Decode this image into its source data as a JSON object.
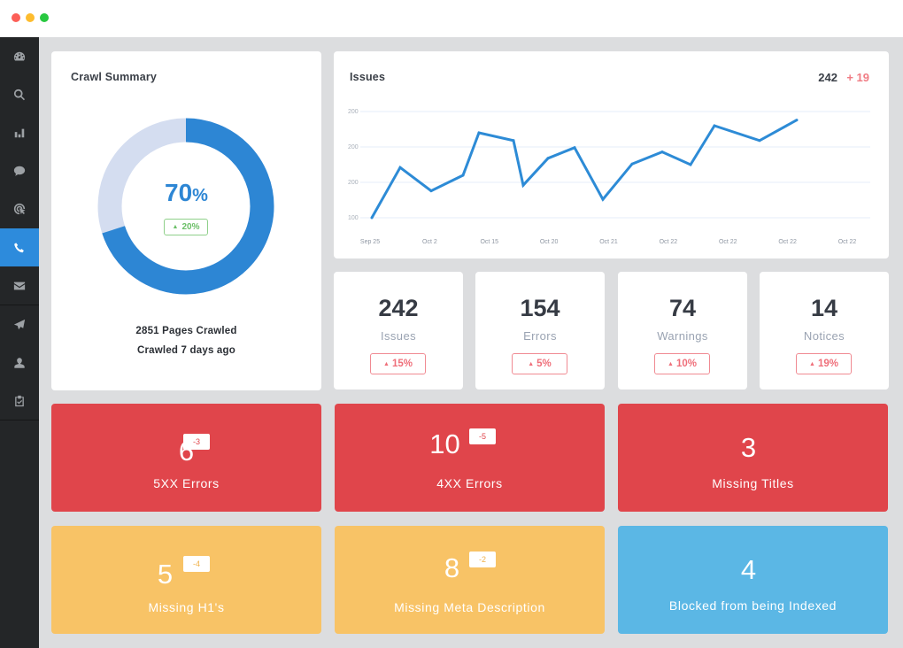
{
  "window": {
    "controls": [
      "close",
      "minimize",
      "maximize"
    ]
  },
  "sidebar": {
    "items": [
      {
        "icon": "dashboard-icon",
        "active": false
      },
      {
        "icon": "search-icon",
        "active": false
      },
      {
        "icon": "bar-chart-icon",
        "active": false
      },
      {
        "icon": "chat-bubble-icon",
        "active": false
      },
      {
        "icon": "target-cursor-icon",
        "active": false
      },
      {
        "icon": "phone-icon",
        "active": true
      },
      {
        "icon": "envelope-icon",
        "active": false
      },
      {
        "icon": "paper-plane-icon",
        "active": false
      },
      {
        "icon": "user-icon",
        "active": false
      },
      {
        "icon": "clipboard-check-icon",
        "active": false
      }
    ]
  },
  "crawl_summary": {
    "title": "Crawl Summary",
    "progress_percent": 70,
    "value": "70",
    "value_unit": "%",
    "change": "20%",
    "change_direction": "up",
    "pages_crawled": "2851 Pages Crawled",
    "last_crawled": "Crawled 7 days ago",
    "colors": {
      "fill": "#2d86d4",
      "track": "#d4ddf0",
      "change": "#6bbf67"
    }
  },
  "issues_chart": {
    "title": "Issues",
    "total": "242",
    "delta": "+ 19"
  },
  "chart_data": {
    "type": "line",
    "title": "Issues",
    "xlabel": "",
    "ylabel": "",
    "y_tick_labels": [
      "200",
      "200",
      "200",
      "100"
    ],
    "ylim": [
      100,
      250
    ],
    "x_tick_labels": [
      "Sep 25",
      "Oct 2",
      "Oct 15",
      "Oct 20",
      "Oct 21",
      "Oct 22",
      "Oct 22",
      "Oct 22",
      "Oct 22"
    ],
    "grid": true,
    "legend": "none",
    "series": [
      {
        "name": "Issues",
        "color": "#2d8bd6",
        "values": [
          100,
          171,
          138,
          160,
          220,
          209,
          146,
          184,
          199,
          126,
          176,
          193,
          175,
          230,
          209,
          238
        ]
      }
    ]
  },
  "stats": [
    {
      "value": "242",
      "label": "Issues",
      "change": "15%"
    },
    {
      "value": "154",
      "label": "Errors",
      "change": "5%"
    },
    {
      "value": "74",
      "label": "Warnings",
      "change": "10%"
    },
    {
      "value": "14",
      "label": "Notices",
      "change": "19%"
    }
  ],
  "tiles": [
    {
      "value": "6",
      "label": "5XX Errors",
      "badge": "-3",
      "color": "red"
    },
    {
      "value": "10",
      "label": "4XX Errors",
      "badge": "-5",
      "color": "red"
    },
    {
      "value": "3",
      "label": "Missing Titles",
      "badge": null,
      "color": "red"
    },
    {
      "value": "5",
      "label": "Missing H1's",
      "badge": "-4",
      "color": "yellow"
    },
    {
      "value": "8",
      "label": "Missing Meta Description",
      "badge": "-2",
      "color": "yellow"
    },
    {
      "value": "4",
      "label": "Blocked from being Indexed",
      "badge": null,
      "color": "blue"
    }
  ],
  "colors": {
    "accent": "#2d8bdc",
    "danger": "#e0454b",
    "warning": "#f8c366",
    "info": "#5bb7e5",
    "negative_change": "#ef6f7a"
  }
}
